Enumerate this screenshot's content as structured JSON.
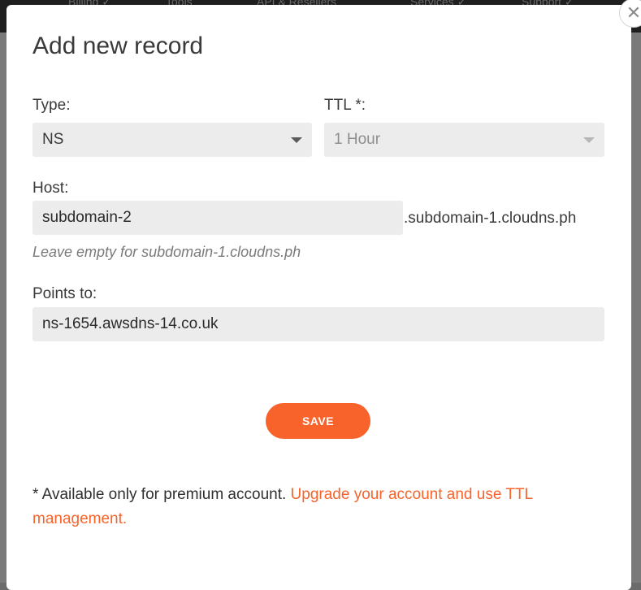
{
  "background": {
    "nav_items": [
      "Billing ✓",
      "Tools",
      "API & Resellers",
      "Services ✓",
      "Support ✓"
    ]
  },
  "modal": {
    "title": "Add new record",
    "close_label": "✕",
    "type_label": "Type:",
    "type_value": "NS",
    "ttl_label": "TTL *:",
    "ttl_value": "1 Hour",
    "host_label": "Host:",
    "host_value": "subdomain-2",
    "host_suffix": ".subdomain-1.cloudns.ph",
    "host_hint": "Leave empty for subdomain-1.cloudns.ph",
    "points_label": "Points to:",
    "points_value": "ns-1654.awsdns-14.co.uk",
    "save_label": "SAVE",
    "footnote_text": "* Available only for premium account. ",
    "footnote_link": "Upgrade your account and use TTL management."
  },
  "colors": {
    "accent": "#f7632b",
    "field_bg": "#ececec"
  }
}
